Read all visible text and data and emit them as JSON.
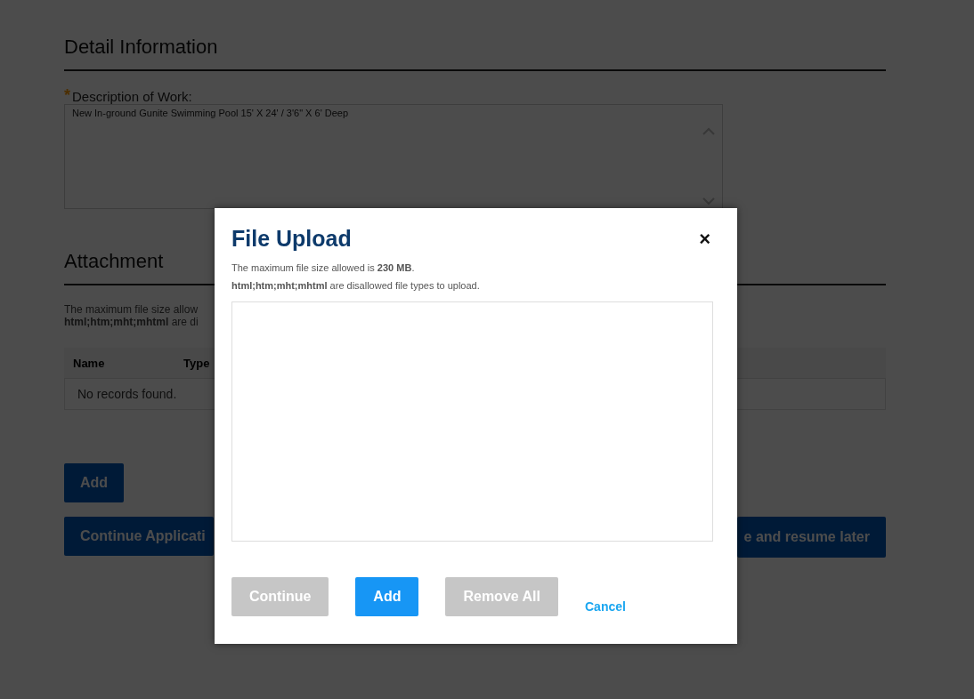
{
  "page": {
    "detail_heading": "Detail Information",
    "description": {
      "required_mark": "*",
      "label": "Description of Work:",
      "value": "New In-ground Gunite Swimming Pool 15' X 24' / 3'6\" X 6' Deep"
    },
    "attachment_heading": "Attachment",
    "notes": [
      "The maximum file size allow",
      "**html;htm;mht;mhtml** are di"
    ],
    "table": {
      "columns": [
        "Name",
        "Type"
      ],
      "empty_text": "No records found."
    },
    "add_button": "Add",
    "buttons": [
      "Continue Applicati",
      "e and resume later"
    ]
  },
  "dialog": {
    "title": "File Upload",
    "close": "×",
    "notes": [
      "The maximum file size allowed is **230 MB**.",
      "**html;htm;mht;mhtml** are disallowed file types to upload."
    ],
    "buttons": [
      {
        "label": "Continue",
        "kind": "button",
        "disabled": true
      },
      {
        "label": "Add",
        "kind": "button",
        "disabled": false
      },
      {
        "label": "Remove All",
        "kind": "button",
        "disabled": true
      },
      {
        "label": "Cancel",
        "kind": "link",
        "disabled": false
      }
    ]
  }
}
